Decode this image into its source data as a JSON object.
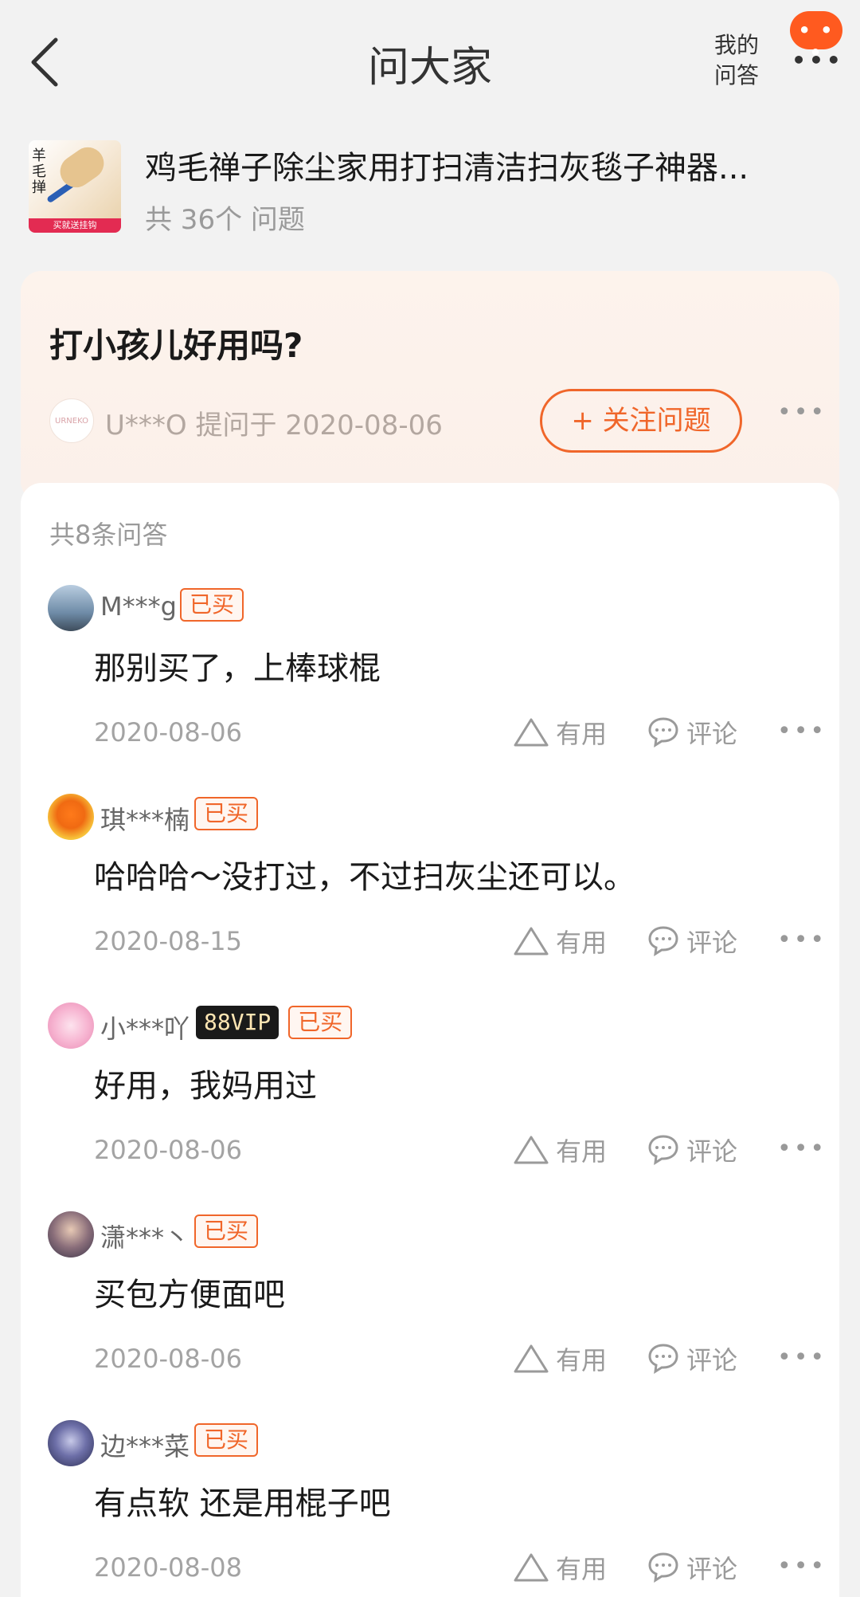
{
  "header": {
    "title": "问大家",
    "my_qa_line1": "我的",
    "my_qa_line2": "问答",
    "accent_color": "#ff5a1f"
  },
  "product": {
    "name": "鸡毛禅子除尘家用打扫清洁扫灰毯子神器...",
    "question_count": "共 36个 问题",
    "thumb_text": "羊毛掸",
    "thumb_band": "买就送挂钩"
  },
  "question": {
    "text": "打小孩儿好用吗?",
    "asker_avatar": "URNEKO",
    "asker": "U***O 提问于 2020-08-06",
    "follow_label": "+ 关注问题"
  },
  "answers_count": "共8条问答",
  "actions": {
    "useful": "有用",
    "comment": "评论"
  },
  "answers": [
    {
      "user": "M***g",
      "vip": "",
      "bought": "已买",
      "text": "那别买了，上棒球棍",
      "date": "2020-08-06",
      "avatar_color": "#5d7fa3"
    },
    {
      "user": "琪***楠",
      "vip": "",
      "bought": "已买",
      "text": "哈哈哈～没打过，不过扫灰尘还可以。",
      "date": "2020-08-15",
      "avatar_color": "#f5a623"
    },
    {
      "user": "小***吖",
      "vip": "88VIP",
      "bought": "已买",
      "text": "好用，我妈用过",
      "date": "2020-08-06",
      "avatar_color": "#f3a6c8"
    },
    {
      "user": "潇***丶",
      "vip": "",
      "bought": "已买",
      "text": "买包方便面吧",
      "date": "2020-08-06",
      "avatar_color": "#6b5d8a"
    },
    {
      "user": "边***菜",
      "vip": "",
      "bought": "已买",
      "text": "有点软 还是用棍子吧",
      "date": "2020-08-08",
      "avatar_color": "#4a4f7a"
    }
  ]
}
